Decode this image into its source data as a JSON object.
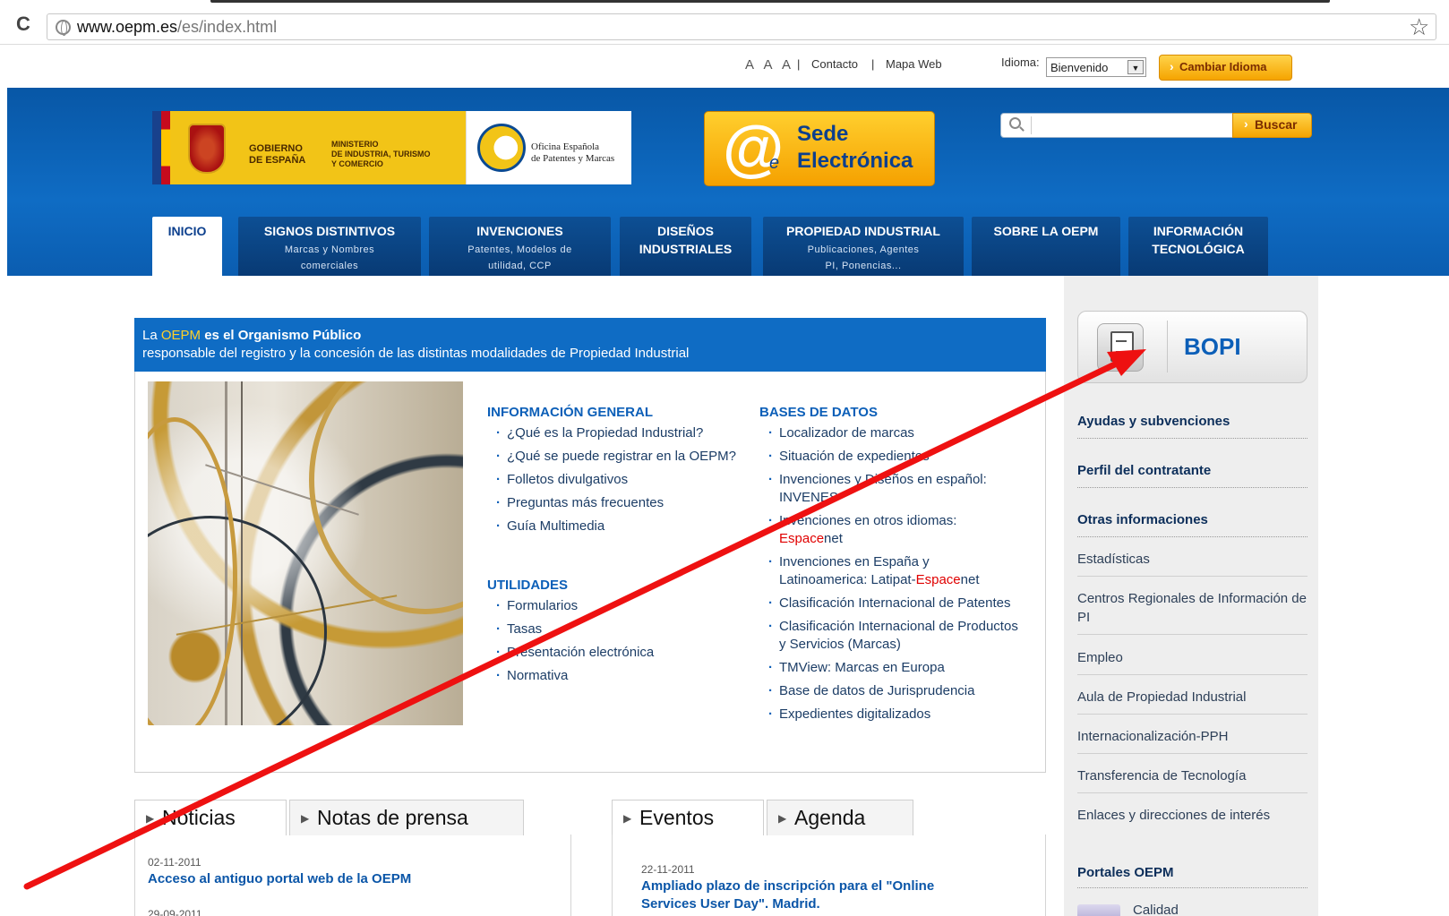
{
  "browser": {
    "url_host": "www.oepm.es",
    "url_path": "/es/index.html"
  },
  "utility": {
    "font_sizes": "A A A",
    "contact": "Contacto",
    "sitemap": "Mapa Web",
    "idioma_label": "Idioma:",
    "language_selected": "Bienvenido",
    "change_language": "Cambiar Idioma"
  },
  "header": {
    "gov_line1": "GOBIERNO",
    "gov_line2": "DE ESPAÑA",
    "ministry_line1": "MINISTERIO",
    "ministry_line2": "DE INDUSTRIA, TURISMO",
    "ministry_line3": "Y COMERCIO",
    "oepm_line1": "Oficina Española",
    "oepm_line2": "de Patentes y Marcas",
    "sede_line1": "Sede",
    "sede_line2": "Electrónica",
    "sede_at": "@",
    "sede_e": "e",
    "search_button": "Buscar"
  },
  "nav": [
    {
      "main": "INICIO",
      "sub": ""
    },
    {
      "main": "SIGNOS DISTINTIVOS",
      "sub1": "Marcas y Nombres",
      "sub2": "comerciales"
    },
    {
      "main": "INVENCIONES",
      "sub1": "Patentes, Modelos de",
      "sub2": "utilidad, CCP"
    },
    {
      "main1": "DISEÑOS",
      "main2": "INDUSTRIALES"
    },
    {
      "main": "PROPIEDAD INDUSTRIAL",
      "sub1": "Publicaciones, Agentes",
      "sub2": "PI, Ponencias..."
    },
    {
      "main": "SOBRE LA OEPM"
    },
    {
      "main1": "INFORMACIÓN",
      "main2": "TECNOLÓGICA"
    }
  ],
  "intro": {
    "la": "La",
    "oepm": "OEPM",
    "line1_rest": "es el Organismo Público",
    "line2": "responsable del registro y la concesión de las distintas modalidades de Propiedad Industrial"
  },
  "info_general": {
    "heading": "INFORMACIÓN GENERAL",
    "items": [
      "¿Qué es la Propiedad Industrial?",
      "¿Qué se puede registrar en la OEPM?",
      "Folletos divulgativos",
      "Preguntas más frecuentes",
      "Guía Multimedia"
    ]
  },
  "utilidades": {
    "heading": "UTILIDADES",
    "items": [
      "Formularios",
      "Tasas",
      "Presentación electrónica",
      "Normativa"
    ]
  },
  "bases_datos": {
    "heading": "BASES DE DATOS",
    "items": [
      "Localizador de marcas",
      "Situación de expedientes",
      "Invenciones y Diseños en español: INVENES",
      "Invenciones en otros idiomas:",
      "Invenciones en España y",
      "Latinoamerica: Latipat-",
      "Clasificación Internacional de Patentes",
      "Clasificación Internacional de Productos y Servicios (Marcas)",
      "TMView: Marcas en Europa",
      "Base de datos de Jurisprudencia",
      "Expedientes digitalizados"
    ],
    "espace_red": "Espace",
    "espace_net": "net"
  },
  "news_tabs": {
    "noticias": "Noticias",
    "notas": "Notas de prensa",
    "eventos": "Eventos",
    "agenda": "Agenda"
  },
  "news": [
    {
      "date": "02-11-2011",
      "title": "Acceso al antiguo portal web de la OEPM"
    },
    {
      "date": "29-09-2011",
      "title": ""
    }
  ],
  "events": [
    {
      "date": "22-11-2011",
      "title_line1": "Ampliado plazo de inscripción para el \"Online",
      "title_line2": "Services User Day\". Madrid."
    }
  ],
  "sidebar": {
    "bopi": "BOPI",
    "ayudas": "Ayudas y subvenciones",
    "perfil": "Perfil del contratante",
    "otras": "Otras informaciones",
    "links": [
      "Estadísticas",
      "Centros Regionales de Información de PI",
      "Empleo",
      "Aula de Propiedad Industrial",
      "Internacionalización-PPH",
      "Transferencia de Tecnología",
      "Enlaces y direcciones de interés"
    ],
    "portales": "Portales OEPM",
    "calidad": "Calidad"
  },
  "annotation": {
    "arrow_color": "#ee1111"
  }
}
